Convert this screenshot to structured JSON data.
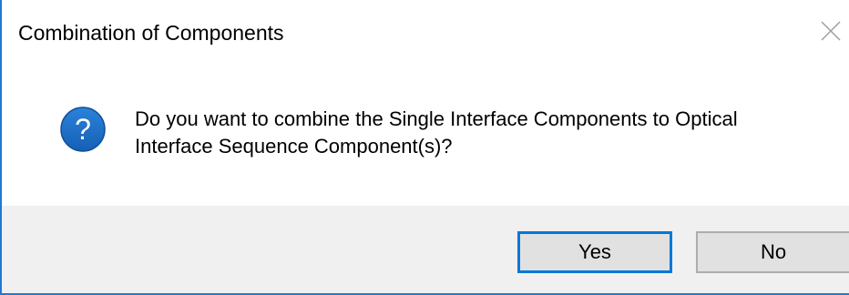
{
  "dialog": {
    "title": "Combination of Components",
    "close_icon": "close-icon",
    "icon": "question-icon",
    "icon_color": "#1f6fc4",
    "message_lines": [
      "Do you want to combine the Single Interface Components to Optical",
      "Interface Sequence Component(s)?"
    ],
    "buttons": {
      "yes_label": "Yes",
      "no_label": "No"
    },
    "accent_color": "#0078d7"
  }
}
